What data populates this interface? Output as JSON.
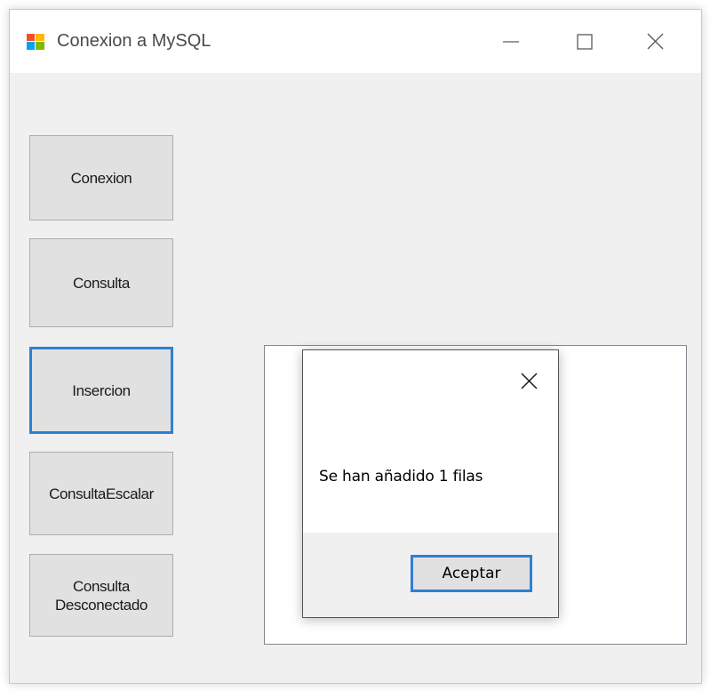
{
  "window": {
    "title": "Conexion a MySQL",
    "icons": [
      "app-icon",
      "minimize-icon",
      "maximize-icon",
      "close-icon"
    ]
  },
  "buttons": {
    "conexion": "Conexion",
    "consulta": "Consulta",
    "insercion": "Insercion",
    "consulta_escalar": "ConsultaEscalar",
    "consulta_desconectado_line1": "Consulta",
    "consulta_desconectado_line2": "Desconectado"
  },
  "dialog": {
    "message": "Se han añadido 1 filas",
    "ok_label": "Aceptar",
    "icons": [
      "close-icon"
    ]
  },
  "colors": {
    "focus_border": "#2f7fd3",
    "window_bg": "#f0f0f0",
    "button_bg": "#e1e1e1"
  }
}
